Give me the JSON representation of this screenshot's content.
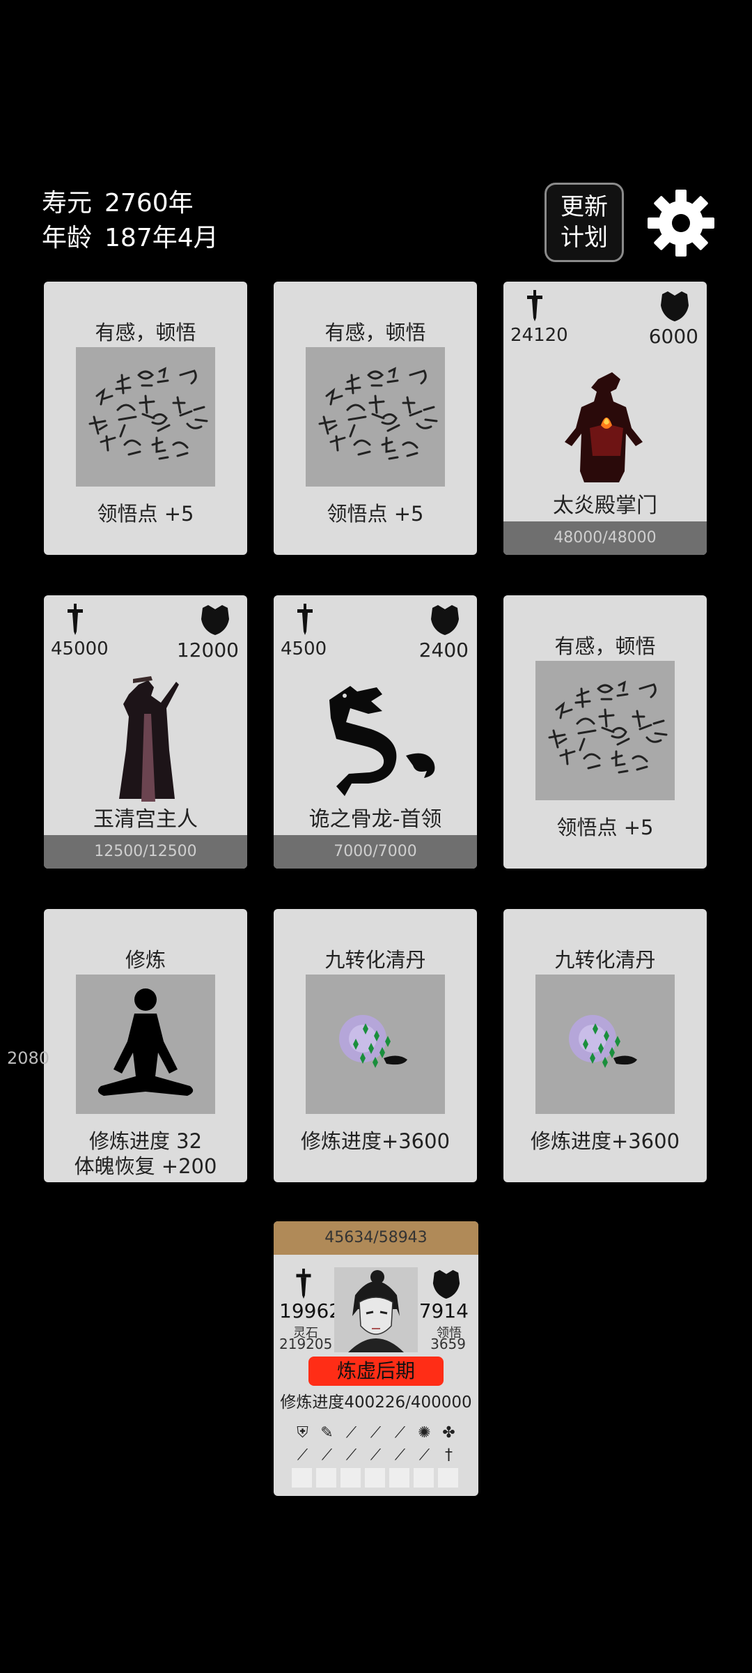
{
  "header": {
    "lifespan_label": "寿元",
    "lifespan_value": "2760年",
    "age_label": "年龄",
    "age_value": "187年4月",
    "update_plan_line1": "更新",
    "update_plan_line2": "计划"
  },
  "cards": [
    {
      "title": "有感，顿悟",
      "effect": "领悟点  +5"
    },
    {
      "title": "有感，顿悟",
      "effect": "领悟点  +5"
    },
    {
      "atk": "24120",
      "def": "6000",
      "name": "太炎殿掌门",
      "hp": "48000/48000"
    },
    {
      "atk": "45000",
      "def": "12000",
      "name": "玉清宫主人",
      "hp": "12500/12500"
    },
    {
      "atk": "4500",
      "def": "2400",
      "name": "诡之骨龙-首领",
      "hp": "7000/7000"
    },
    {
      "title": "有感，顿悟",
      "effect": "领悟点  +5"
    },
    {
      "title": "修炼",
      "line1": "修炼进度  32",
      "line2": "体魄恢复  +200"
    },
    {
      "title": "九转化清丹",
      "effect": "修炼进度+3600"
    },
    {
      "title": "九转化清丹",
      "effect": "修炼进度+3600"
    }
  ],
  "side_number": "2080",
  "player": {
    "exp": "45634/58943",
    "atk": "19962",
    "def": "7914",
    "stone_label": "灵石",
    "stone_value": "219205",
    "insight_label": "领悟",
    "insight_value": "3659",
    "realm": "炼虚后期",
    "progress_label": "修炼进度",
    "progress_value": "400226/400000"
  }
}
